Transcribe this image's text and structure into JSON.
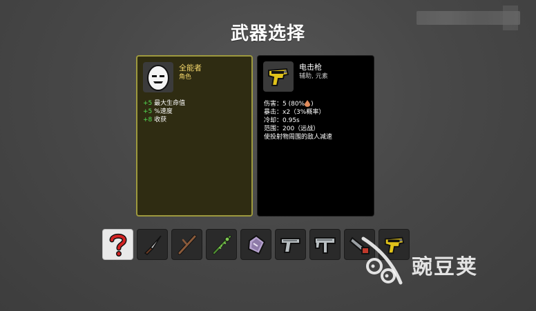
{
  "screen": {
    "title": "武器选择"
  },
  "character": {
    "name": "全能者",
    "subtitle": "角色",
    "stats": [
      {
        "value": "+5",
        "label": "最大生命值"
      },
      {
        "value": "+5",
        "label": "%速度"
      },
      {
        "value": "+8",
        "label": "收获"
      }
    ]
  },
  "weapon": {
    "name": "电击枪",
    "subtitle": "辅助, 元素",
    "stats": {
      "damage_prefix": "伤害：5 (80%",
      "damage_suffix": ")",
      "crit": "暴击：x2（3%概率）",
      "cooldown": "冷却：0.95s",
      "range": "范围：200（远战）",
      "effect": "使投射物周围的敌人减速"
    }
  },
  "weapon_slots": [
    {
      "icon": "question-mark-icon",
      "selected": true
    },
    {
      "icon": "knife-icon",
      "selected": false
    },
    {
      "icon": "stick-icon",
      "selected": false
    },
    {
      "icon": "thorn-spear-icon",
      "selected": false
    },
    {
      "icon": "crystal-shield-icon",
      "selected": false
    },
    {
      "icon": "pistol-icon",
      "selected": false
    },
    {
      "icon": "smg-icon",
      "selected": false
    },
    {
      "icon": "chainsaw-icon",
      "selected": false
    },
    {
      "icon": "taser-icon",
      "selected": false
    }
  ],
  "watermark": {
    "text": "豌豆荚"
  },
  "colors": {
    "highlight_stat": "#55e055",
    "character_accent": "#f2d56b",
    "character_border": "#9e9a3e",
    "selected_slot": "#e9e9e9",
    "question_mark": "#d42323"
  }
}
